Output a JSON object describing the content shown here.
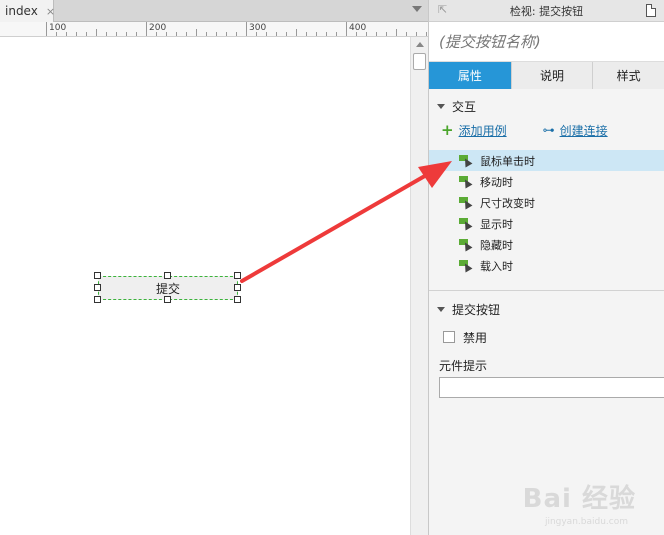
{
  "editor": {
    "tab_label": "index",
    "tab_close": "×",
    "ruler_labels": [
      "100",
      "200",
      "300",
      "400"
    ]
  },
  "canvas": {
    "submit_button_label": "提交"
  },
  "inspector": {
    "title": "检视: 提交按钮",
    "widget_name": "(提交按钮名称)",
    "tabs": [
      {
        "label": "属性",
        "active": true
      },
      {
        "label": "说明",
        "active": false
      },
      {
        "label": "样式",
        "active": false
      }
    ],
    "interaction": {
      "section_title": "交互",
      "add_case_label": "添加用例",
      "create_link_label": "创建连接",
      "events": [
        {
          "label": "鼠标单击时",
          "selected": true
        },
        {
          "label": "移动时",
          "selected": false
        },
        {
          "label": "尺寸改变时",
          "selected": false
        },
        {
          "label": "显示时",
          "selected": false
        },
        {
          "label": "隐藏时",
          "selected": false
        },
        {
          "label": "载入时",
          "selected": false
        }
      ]
    },
    "submit_section": {
      "section_title": "提交按钮",
      "disable_label": "禁用",
      "disabled": false,
      "tooltip_label": "元件提示",
      "tooltip_value": ""
    }
  },
  "watermark": {
    "text": "Bai 经验",
    "sub": "jingyan.baidu.com"
  },
  "colors": {
    "active_tab": "#2696d7",
    "selected_row": "#cde7f5",
    "arrow": "#ee3a3a",
    "selection_border": "#3bb33b",
    "link": "#1b6fa8"
  }
}
